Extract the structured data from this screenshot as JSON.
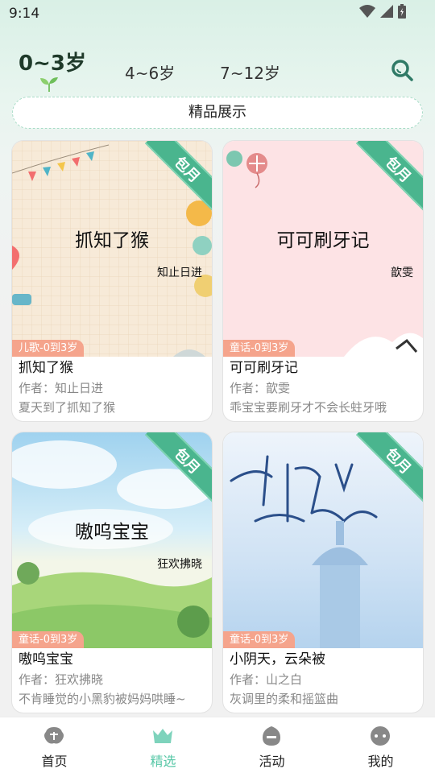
{
  "status": {
    "time": "9:14"
  },
  "age_tabs": [
    {
      "label": "0~3岁",
      "active": true
    },
    {
      "label": "4~6岁",
      "active": false
    },
    {
      "label": "7~12岁",
      "active": false
    }
  ],
  "banner": {
    "label": "精品展示"
  },
  "ribbon_label": "包月",
  "cards": [
    {
      "cover_title": "抓知了猴",
      "cover_author": "知止日进",
      "tag": "儿歌-0到3岁",
      "title": "抓知了猴",
      "author": "作者：知止日进",
      "desc": "夏天到了抓知了猴",
      "cover_bg": "#f7ead8"
    },
    {
      "cover_title": "可可刷牙记",
      "cover_author": "歆雯",
      "tag": "童话-0到3岁",
      "title": "可可刷牙记",
      "author": "作者：歆雯",
      "desc": "乖宝宝要刷牙才不会长蛀牙哦",
      "cover_bg": "#fde3e5"
    },
    {
      "cover_title": "嗷呜宝宝",
      "cover_author": "狂欢拂晓",
      "tag": "童话-0到3岁",
      "title": "嗷呜宝宝",
      "author": "作者：狂欢拂晓",
      "desc": "不肯睡觉的小黑豹被妈妈哄睡~",
      "cover_bg": "#bfe3f2"
    },
    {
      "cover_title": "",
      "cover_author": "",
      "tag": "童话-0到3岁",
      "title": "小阴天，云朵被",
      "author": "作者：山之白",
      "desc": "灰调里的柔和摇篮曲",
      "cover_bg": "#d8e8f6"
    }
  ],
  "nav": [
    {
      "label": "首页",
      "icon": "home-icon",
      "active": false
    },
    {
      "label": "精选",
      "icon": "crown-icon",
      "active": true
    },
    {
      "label": "活动",
      "icon": "activity-icon",
      "active": false
    },
    {
      "label": "我的",
      "icon": "profile-icon",
      "active": false
    }
  ],
  "colors": {
    "accent": "#56c7a6",
    "ribbon": "#4ab58e",
    "tag": "#f5a48c"
  }
}
